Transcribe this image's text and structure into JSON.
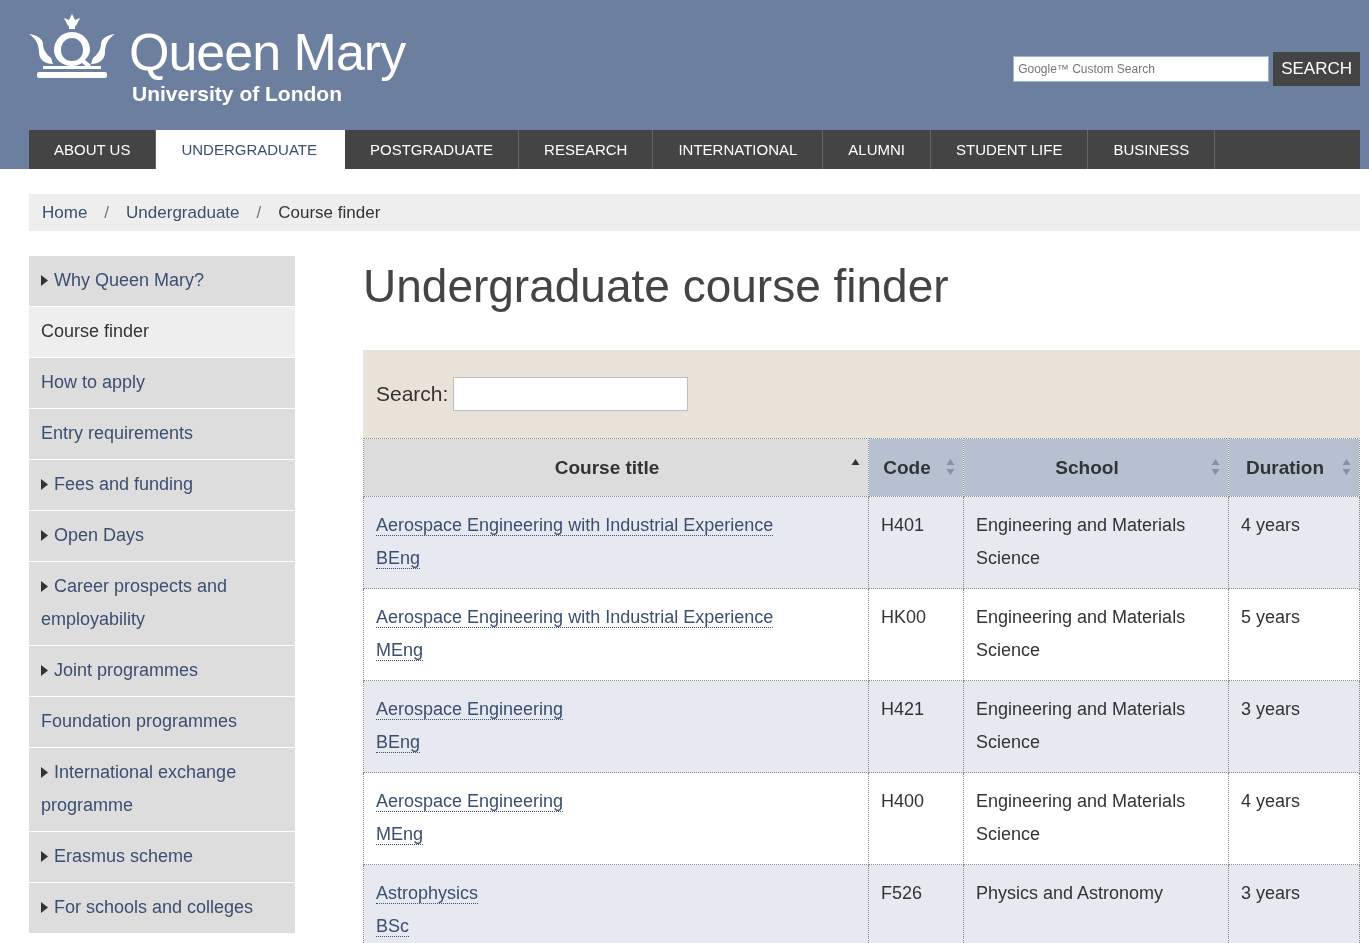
{
  "header": {
    "logo_title": "Queen Mary",
    "logo_subtitle": "University of London",
    "search": {
      "placeholder": "Google™ Custom Search",
      "button": "SEARCH"
    }
  },
  "nav": [
    {
      "label": "ABOUT US",
      "selected": false
    },
    {
      "label": "UNDERGRADUATE",
      "selected": true
    },
    {
      "label": "POSTGRADUATE",
      "selected": false
    },
    {
      "label": "RESEARCH",
      "selected": false
    },
    {
      "label": "INTERNATIONAL",
      "selected": false
    },
    {
      "label": "ALUMNI",
      "selected": false
    },
    {
      "label": "STUDENT LIFE",
      "selected": false
    },
    {
      "label": "BUSINESS",
      "selected": false
    }
  ],
  "breadcrumb": {
    "separator": "/",
    "items": [
      "Home",
      "Undergraduate",
      "Course finder"
    ]
  },
  "sidebar": {
    "items": [
      {
        "label": "Why Queen Mary?",
        "expandable": true,
        "selected": false
      },
      {
        "label": "Course finder",
        "expandable": false,
        "selected": true
      },
      {
        "label": "How to apply",
        "expandable": false,
        "selected": false
      },
      {
        "label": "Entry requirements",
        "expandable": false,
        "selected": false
      },
      {
        "label": "Fees and funding",
        "expandable": true,
        "selected": false
      },
      {
        "label": "Open Days",
        "expandable": true,
        "selected": false
      },
      {
        "label": "Career prospects and employability",
        "expandable": true,
        "selected": false
      },
      {
        "label": "Joint programmes",
        "expandable": true,
        "selected": false
      },
      {
        "label": "Foundation programmes",
        "expandable": false,
        "selected": false
      },
      {
        "label": "International exchange programme",
        "expandable": true,
        "selected": false
      },
      {
        "label": "Erasmus scheme",
        "expandable": true,
        "selected": false
      },
      {
        "label": "For schools and colleges",
        "expandable": true,
        "selected": false
      }
    ]
  },
  "page_title": "Undergraduate course finder",
  "filter": {
    "label": "Search:"
  },
  "table": {
    "columns": [
      {
        "label": "Course title",
        "sorted": true
      },
      {
        "label": "Code",
        "sorted": false
      },
      {
        "label": "School",
        "sorted": false
      },
      {
        "label": "Duration",
        "sorted": false
      }
    ],
    "rows": [
      {
        "title": "Aerospace Engineering with Industrial Experience",
        "degree": "BEng",
        "code": "H401",
        "school": "Engineering and Materials Science",
        "duration": "4 years"
      },
      {
        "title": "Aerospace Engineering with Industrial Experience",
        "degree": "MEng",
        "code": "HK00",
        "school": "Engineering and Materials Science",
        "duration": "5 years"
      },
      {
        "title": "Aerospace Engineering",
        "degree": "BEng",
        "code": "H421",
        "school": "Engineering and Materials Science",
        "duration": "3 years"
      },
      {
        "title": "Aerospace Engineering",
        "degree": "MEng",
        "code": "H400",
        "school": "Engineering and Materials Science",
        "duration": "4 years"
      },
      {
        "title": "Astrophysics",
        "degree": "BSc",
        "code": "F526",
        "school": "Physics and Astronomy",
        "duration": "3 years"
      }
    ]
  }
}
